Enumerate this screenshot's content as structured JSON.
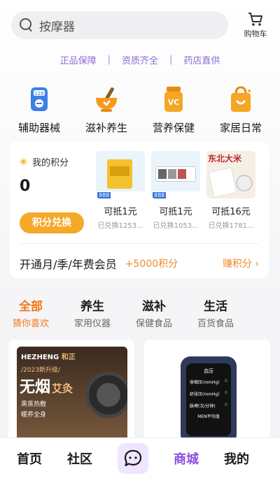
{
  "search": {
    "placeholder": "按摩器"
  },
  "cart": {
    "label": "购物车"
  },
  "guarantee": [
    "正品保障",
    "资质齐全",
    "药店直供"
  ],
  "guarantee_sep": "|",
  "categories": [
    {
      "label": "辅助器械",
      "icon": "medical-device-icon",
      "badge": "128"
    },
    {
      "label": "滋补养生",
      "icon": "mortar-bowl-icon"
    },
    {
      "label": "营养保健",
      "icon": "vitamin-bottle-icon",
      "badge": "VC"
    },
    {
      "label": "家居日常",
      "icon": "shopping-bag-icon"
    }
  ],
  "points": {
    "label": "我的积分",
    "value": "0",
    "redeem": "积分兑换",
    "products": [
      {
        "price": "可抵1元",
        "redeemed": "已兑换1253...",
        "tag": "888"
      },
      {
        "price": "可抵1元",
        "redeemed": "已兑换1053...",
        "tag": "888"
      },
      {
        "price": "可抵16元",
        "redeemed": "已兑换1781...",
        "banner": "东北大米"
      }
    ],
    "vip": {
      "title": "开通月/季/年费会员",
      "bonus": "+5000积分",
      "earn": "赚积分 ›"
    }
  },
  "tabs": [
    {
      "main": "全部",
      "sub": "猜你喜欢",
      "active": true
    },
    {
      "main": "养生",
      "sub": "家用仪器"
    },
    {
      "main": "滋补",
      "sub": "保健食品"
    },
    {
      "main": "生活",
      "sub": "百货食品"
    }
  ],
  "cards": [
    {
      "brand": "HEZHENG",
      "brand_cn": "和正",
      "tag": "/2023新升级/",
      "title": "无烟",
      "title2": "艾灸",
      "lines": [
        "熏蒸热敷",
        "暖养全身"
      ]
    },
    {
      "screen_title": "血压",
      "rows": [
        "收缩压(mmHg)",
        "舒张压(mmHg)",
        "脉搏(次/分钟)",
        "MEN平均值"
      ],
      "values": [
        "0",
        "0",
        "0"
      ]
    }
  ],
  "nav": [
    "首页",
    "社区",
    "商城",
    "我的"
  ],
  "colors": {
    "accent": "#8b4fe3",
    "orange": "#ef7a1a",
    "redeem": "#f4a928"
  }
}
